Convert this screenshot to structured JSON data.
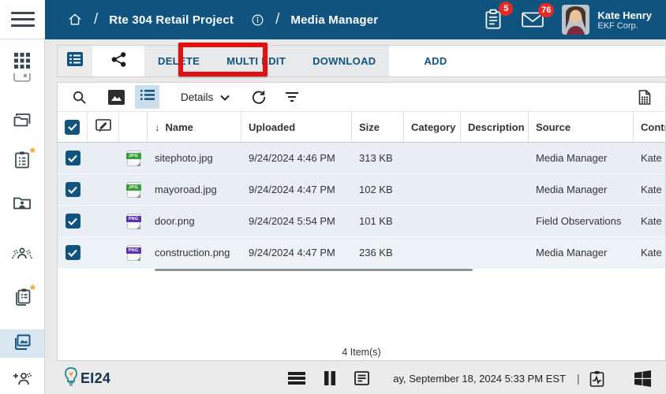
{
  "topbar": {
    "project": "Rte 304 Retail Project",
    "separator1": "/",
    "separator2": "/",
    "page": "Media Manager",
    "tasks_badge": "5",
    "mail_badge": "76",
    "user_name": "Kate Henry",
    "user_org": "EKF Corp."
  },
  "toolbar": {
    "delete": "DELETE",
    "multi_edit": "MULTI EDIT",
    "download": "DOWNLOAD",
    "add": "ADD"
  },
  "grid_toolbar": {
    "view_mode": "Details"
  },
  "table": {
    "sort_arrow": "↓",
    "headers": {
      "name": "Name",
      "uploaded": "Uploaded",
      "size": "Size",
      "category": "Category",
      "description": "Description",
      "source": "Source",
      "contributor": "Contri"
    },
    "rows": [
      {
        "name": "sitephoto.jpg",
        "ext": "JPG",
        "uploaded": "9/24/2024 4:46 PM",
        "size": "313 KB",
        "category": "",
        "description": "",
        "source": "Media Manager",
        "contributor": "Kate H"
      },
      {
        "name": "mayoroad.jpg",
        "ext": "JPG",
        "uploaded": "9/24/2024 4:47 PM",
        "size": "102 KB",
        "category": "",
        "description": "",
        "source": "Media Manager",
        "contributor": "Kate H"
      },
      {
        "name": "door.png",
        "ext": "PNG",
        "uploaded": "9/24/2024 5:54 PM",
        "size": "101 KB",
        "category": "",
        "description": "",
        "source": "Field Observations",
        "contributor": "Kate H"
      },
      {
        "name": "construction.png",
        "ext": "PNG",
        "uploaded": "9/24/2024 4:47 PM",
        "size": "236 KB",
        "category": "",
        "description": "",
        "source": "Media Manager",
        "contributor": "Kate H"
      }
    ],
    "count": "4 Item(s)"
  },
  "taskbar": {
    "logo": "EI24",
    "datetime": "ay, September 18, 2024 5:33 PM EST",
    "separator": "|"
  },
  "colors": {
    "header_blue": "#10537F",
    "badge_red": "#E02B27",
    "annotation_red": "#DE1212",
    "selected_row": "#E9EEF4",
    "asterisk_orange": "#F59A23",
    "jpg_green": "#3E9B3E",
    "png_purple": "#5C35A8"
  }
}
